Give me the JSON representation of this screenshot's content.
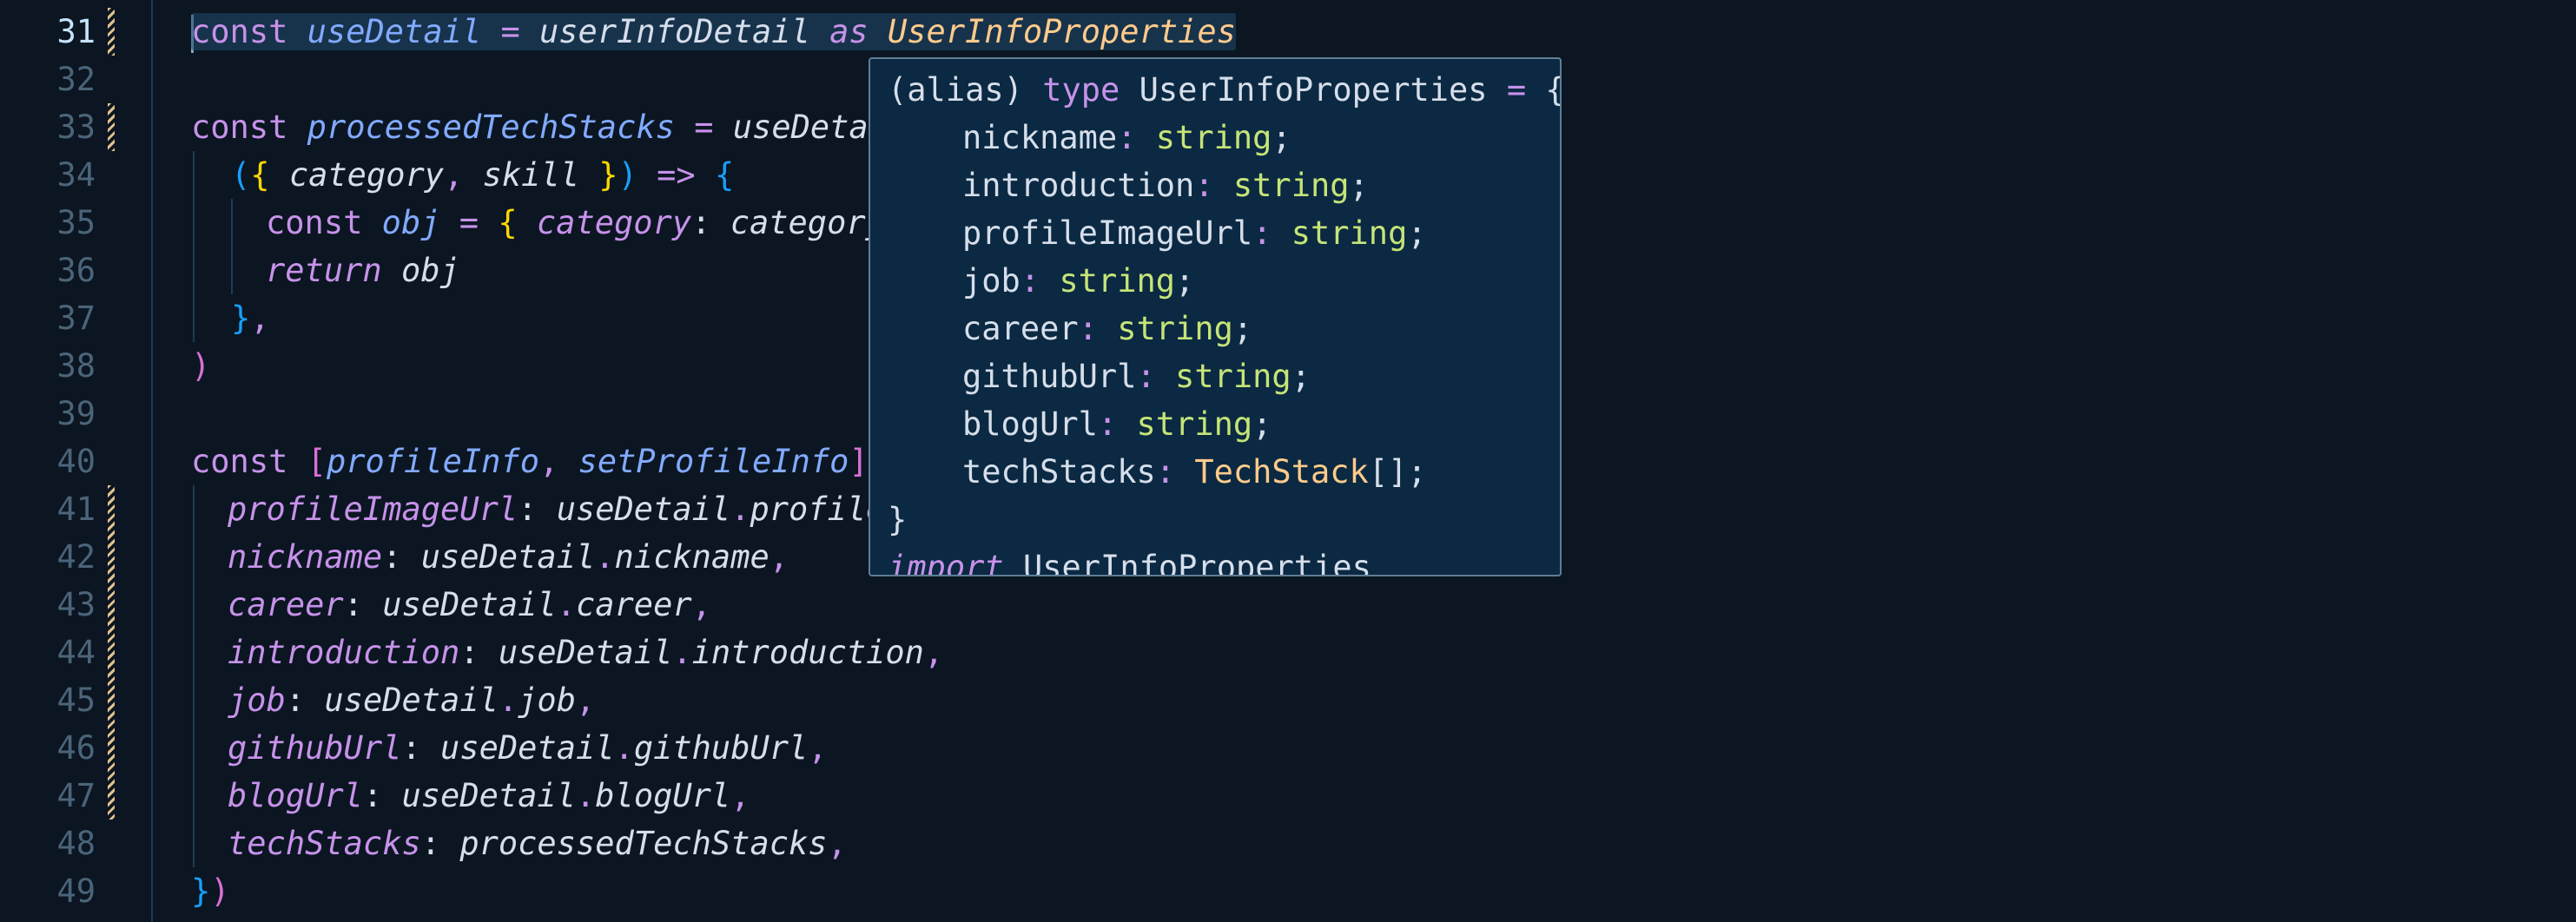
{
  "editor": {
    "line_numbers": [
      "31",
      "32",
      "33",
      "34",
      "35",
      "36",
      "37",
      "38",
      "39",
      "40",
      "41",
      "42",
      "43",
      "44",
      "45",
      "46",
      "47",
      "48",
      "49"
    ],
    "active_line": "31",
    "code": {
      "l31": {
        "const": "const",
        "useDetail": "useDetail",
        "eq": "=",
        "userInfoDetail": "userInfoDetail",
        "as": "as",
        "type": "UserInfoProperties"
      },
      "l33": {
        "const": "const",
        "name": "processedTechStacks",
        "eq": "=",
        "rest": "useDetai"
      },
      "l34": {
        "open_paren": "(",
        "open_brace": "{",
        "category": "category",
        "comma": ",",
        "skill": "skill",
        "close_brace": "}",
        "close_paren": ")",
        "arrow": "=>",
        "body_brace": "{"
      },
      "l35": {
        "const": "const",
        "obj": "obj",
        "eq": "=",
        "open": "{",
        "key": "category",
        "colon": ":",
        "val": "category"
      },
      "l36": {
        "return": "return",
        "obj": "obj"
      },
      "l37": {
        "brace": "}",
        "comma": ","
      },
      "l38": {
        "paren": ")"
      },
      "l40": {
        "const": "const",
        "open": "[",
        "a": "profileInfo",
        "comma": ",",
        "b": "setProfileInfo",
        "close": "]"
      },
      "l41": {
        "key": "profileImageUrl",
        "colon": ":",
        "obj": "useDetail",
        "dot": ".",
        "rest": "profile"
      },
      "l42": {
        "key": "nickname",
        "colon": ":",
        "obj": "useDetail",
        "dot": ".",
        "prop": "nickname",
        "comma": ","
      },
      "l43": {
        "key": "career",
        "colon": ":",
        "obj": "useDetail",
        "dot": ".",
        "prop": "career",
        "comma": ","
      },
      "l44": {
        "key": "introduction",
        "colon": ":",
        "obj": "useDetail",
        "dot": ".",
        "prop": "introduction",
        "comma": ","
      },
      "l45": {
        "key": "job",
        "colon": ":",
        "obj": "useDetail",
        "dot": ".",
        "prop": "job",
        "comma": ","
      },
      "l46": {
        "key": "githubUrl",
        "colon": ":",
        "obj": "useDetail",
        "dot": ".",
        "prop": "githubUrl",
        "comma": ","
      },
      "l47": {
        "key": "blogUrl",
        "colon": ":",
        "obj": "useDetail",
        "dot": ".",
        "prop": "blogUrl",
        "comma": ","
      },
      "l48": {
        "key": "techStacks",
        "colon": ":",
        "val": "processedTechStacks",
        "comma": ","
      },
      "l49": {
        "brace": "}",
        "paren": ")"
      }
    }
  },
  "hover": {
    "header_prefix": "(alias)",
    "header_type_kw": "type",
    "header_name": "UserInfoProperties",
    "header_eq": "=",
    "header_open": "{",
    "fields": [
      {
        "name": "nickname",
        "type": "string"
      },
      {
        "name": "introduction",
        "type": "string"
      },
      {
        "name": "profileImageUrl",
        "type": "string"
      },
      {
        "name": "job",
        "type": "string"
      },
      {
        "name": "career",
        "type": "string"
      },
      {
        "name": "githubUrl",
        "type": "string"
      },
      {
        "name": "blogUrl",
        "type": "string"
      },
      {
        "name": "techStacks",
        "type": "TechStack",
        "suffix": "[]"
      }
    ],
    "close": "}",
    "import_kw": "import",
    "import_name": "UserInfoProperties"
  },
  "colors": {
    "background": "#0b1622",
    "hover_background": "#0b2942",
    "keyword": "#c792ea",
    "variable": "#82aaff",
    "string_type": "#c5e478",
    "type_name": "#ffcb8b"
  }
}
